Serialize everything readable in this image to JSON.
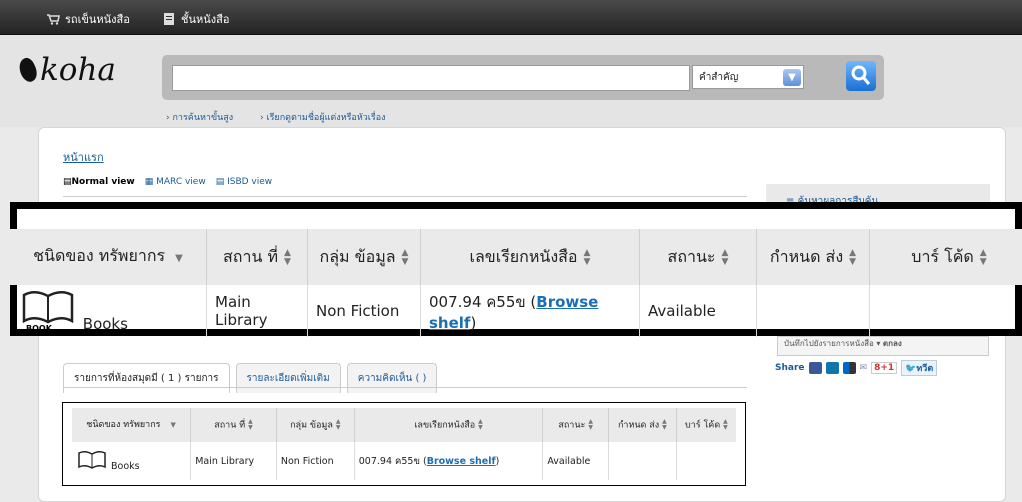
{
  "topbar": {
    "cart": "รถเข็นหนังสือ",
    "shelves": "ชั้นหนังสือ"
  },
  "logo": "koha",
  "search": {
    "query": "",
    "index_selected": "คำสำคัญ"
  },
  "sublinks": [
    "การค้นหาขั้นสูง",
    "เรียกดูตามชื่อผู้แต่งหรือหัวเรื่อง"
  ],
  "breadcrumb": "หน้าแรก",
  "views": [
    "Normal view",
    "MARC view",
    "ISBD view"
  ],
  "sidebar": {
    "browse": "ค้นหาผลการสืบค้น",
    "save_option": "บันทึกไปยังรายการหนังสือ",
    "save_button": "ตกลง"
  },
  "holdings": {
    "headers": [
      "ชนิดของ ทรัพยากร",
      "สถาน ที่",
      "กลุ่ม ข้อมูล",
      "เลขเรียกหนังสือ",
      "สถานะ",
      "กำหนด ส่ง",
      "บาร์ โค้ด"
    ],
    "row": {
      "item_type": "Books",
      "icon_label": "BOOK",
      "location": "Main Library",
      "collection": "Non Fiction",
      "call_number": "007.94 ค55ข",
      "browse": "Browse shelf",
      "status": "Available",
      "due": "",
      "barcode": ""
    }
  },
  "share": {
    "label": "Share",
    "gplus": "8+1",
    "tweet": "ทวีต"
  },
  "tabs": [
    "รายการที่ห้องสมุดมี ( 1 ) รายการ",
    "รายละเอียดเพิ่มเติม",
    "ความคิดเห็น ( )"
  ],
  "colors": {
    "topbar": "#2b2b2b",
    "link": "#1a5b9a",
    "search_btn": "#1a6fd3"
  }
}
